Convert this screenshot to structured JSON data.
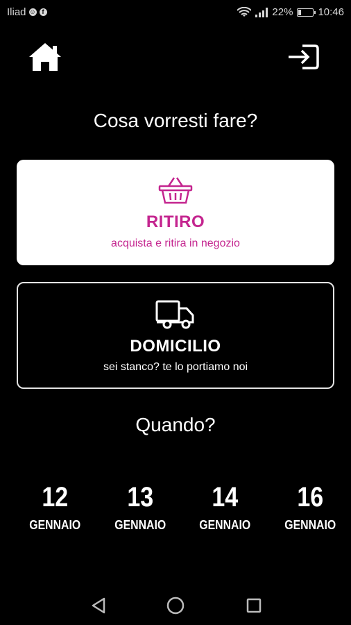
{
  "status_bar": {
    "carrier": "Iliad",
    "battery": "22%",
    "battery_level": 0.22,
    "time": "10:46"
  },
  "icons": {
    "home": "home-icon",
    "logout": "logout-icon",
    "basket": "basket-icon",
    "truck": "truck-icon"
  },
  "colors": {
    "background": "#000000",
    "accent": "#c4258f",
    "card_light": "#ffffff"
  },
  "question_what": "Cosa vorresti fare?",
  "options": [
    {
      "title": "RITIRO",
      "subtitle": "acquista e ritira in negozio"
    },
    {
      "title": "DOMICILIO",
      "subtitle": "sei stanco? te lo portiamo noi"
    }
  ],
  "question_when": "Quando?",
  "dates": [
    {
      "day": "12",
      "month": "GENNAIO"
    },
    {
      "day": "13",
      "month": "GENNAIO"
    },
    {
      "day": "14",
      "month": "GENNAIO"
    },
    {
      "day": "16",
      "month": "GENNAIO"
    }
  ]
}
